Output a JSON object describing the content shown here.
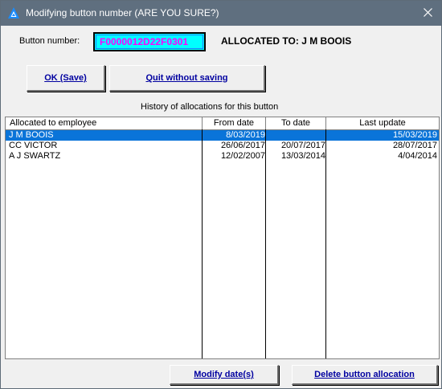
{
  "window": {
    "title": "Modifying button number (ARE YOU SURE?)",
    "close_glyph": "✕",
    "app_icon": "app-triangle-icon"
  },
  "form": {
    "button_number_label": "Button number:",
    "button_number_value": "F0000012D22F0301",
    "allocated_to": "ALLOCATED TO: J M BOOIS"
  },
  "buttons": {
    "ok": "OK (Save)",
    "quit": "Quit without saving",
    "modify_dates": "Modify date(s)",
    "delete_allocation": "Delete button allocation"
  },
  "history_label": "History of allocations for this button",
  "table": {
    "columns": [
      "Allocated to employee",
      "From date",
      "To date",
      "Last update"
    ],
    "rows": [
      {
        "employee": "J M BOOIS",
        "from": "8/03/2019",
        "to": "",
        "updated": "15/03/2019",
        "selected": true
      },
      {
        "employee": "CC VICTOR",
        "from": "26/06/2017",
        "to": "20/07/2017",
        "updated": "28/07/2017",
        "selected": false
      },
      {
        "employee": "A J SWARTZ",
        "from": "12/02/2007",
        "to": "13/03/2014",
        "updated": "4/04/2014",
        "selected": false
      }
    ]
  },
  "colors": {
    "titlebar": "#5f6f7f",
    "field_bg": "#00ffff",
    "field_text": "#ff00ff",
    "button_text": "#0000a0",
    "selection": "#0a74d9"
  }
}
